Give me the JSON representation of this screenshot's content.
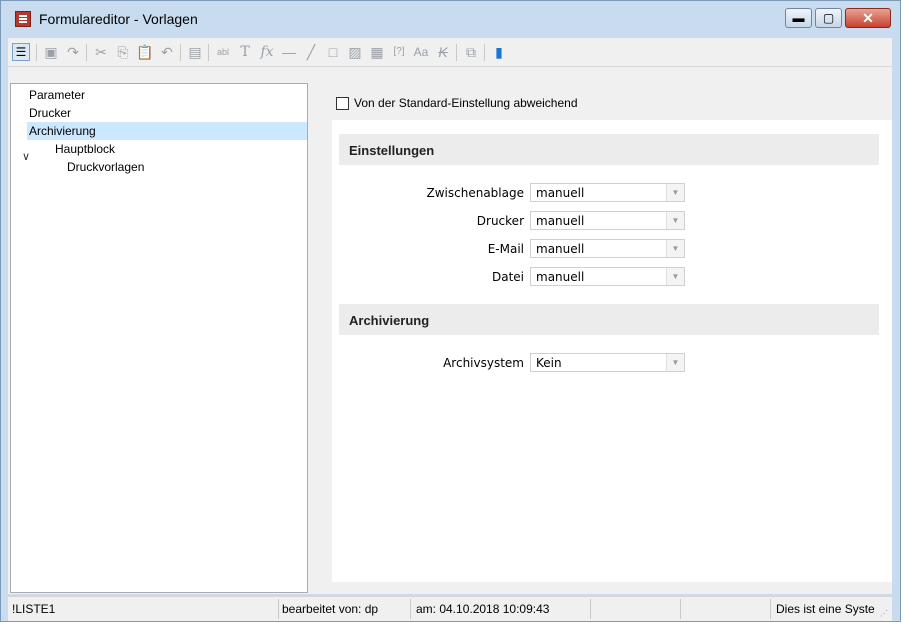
{
  "window": {
    "title": "Formulareditor - Vorlagen",
    "minimize_icon": "minimize-icon",
    "maximize_icon": "maximize-icon",
    "close_icon": "close-icon"
  },
  "toolbar": {
    "icons": [
      "tree-view-icon",
      "save-icon",
      "redo-icon",
      "cut-icon",
      "copy-icon",
      "paste-icon",
      "undo-icon",
      "properties-icon",
      "field-icon",
      "text-icon",
      "formula-icon",
      "line-horizontal-icon",
      "line-diagonal-icon",
      "rectangle-icon",
      "image-icon",
      "barcode-icon",
      "placeholder-icon",
      "font-icon",
      "strikethrough-icon",
      "structure-icon",
      "book-icon"
    ]
  },
  "tree": {
    "items": [
      {
        "label": "Parameter"
      },
      {
        "label": "Drucker"
      },
      {
        "label": "Archivierung"
      },
      {
        "label": "Hauptblock"
      },
      {
        "label": "Druckvorlagen"
      }
    ]
  },
  "settings": {
    "override_label": "Von der Standard-Einstellung abweichend",
    "override_checked": false,
    "einstellungen_header": "Einstellungen",
    "fields": [
      {
        "label": "Zwischenablage",
        "value": "manuell"
      },
      {
        "label": "Drucker",
        "value": "manuell"
      },
      {
        "label": "E-Mail",
        "value": "manuell"
      },
      {
        "label": "Datei",
        "value": "manuell"
      }
    ],
    "archivierung_header": "Archivierung",
    "archivsystem_label": "Archivsystem",
    "archivsystem_value": "Kein"
  },
  "statusbar": {
    "list_name": "!LISTE1",
    "edited_by": "bearbeitet von: dp",
    "timestamp": "am: 04.10.2018 10:09:43",
    "info": "Dies ist eine Syste"
  }
}
